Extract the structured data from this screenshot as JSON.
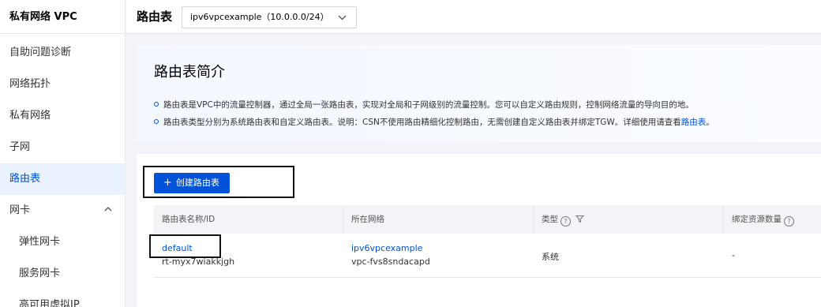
{
  "sidebar": {
    "title": "私有网络 VPC",
    "items": [
      {
        "label": "自助问题诊断"
      },
      {
        "label": "网络拓扑"
      },
      {
        "label": "私有网络"
      },
      {
        "label": "子网"
      },
      {
        "label": "路由表"
      },
      {
        "label": "网卡"
      }
    ],
    "sub_items": [
      {
        "label": "弹性网卡"
      },
      {
        "label": "服务网卡"
      },
      {
        "label": "高可用虚拟IP"
      }
    ]
  },
  "header": {
    "title": "路由表",
    "vpc_select": "ipv6vpcexample（10.0.0.0/24）"
  },
  "intro": {
    "title": "路由表简介",
    "line1": "路由表是VPC中的流量控制器，通过全局一张路由表，实现对全局和子网级别的流量控制。您可以自定义路由规则，控制网络流量的导向目的地。",
    "line2_prefix": "路由表类型分别为系统路由表和自定义路由表。说明：CSN不使用路由精细化控制路由，无需创建自定义路由表并绑定TGW。详细使用请查看",
    "line2_link": "路由表",
    "line2_suffix": "。"
  },
  "toolbar": {
    "create_label": "创建路由表"
  },
  "table": {
    "headers": [
      "路由表名称/ID",
      "所在网络",
      "类型",
      "绑定资源数量"
    ],
    "rows": [
      {
        "name": "default",
        "id": "rt-myx7wiakkjgh",
        "network_name": "ipv6vpcexample",
        "network_id": "vpc-fvs8sndacapd",
        "type": "系统",
        "bound": "-"
      }
    ]
  },
  "colors": {
    "accent": "#0052d9",
    "active_bg": "#ebf2ff"
  }
}
